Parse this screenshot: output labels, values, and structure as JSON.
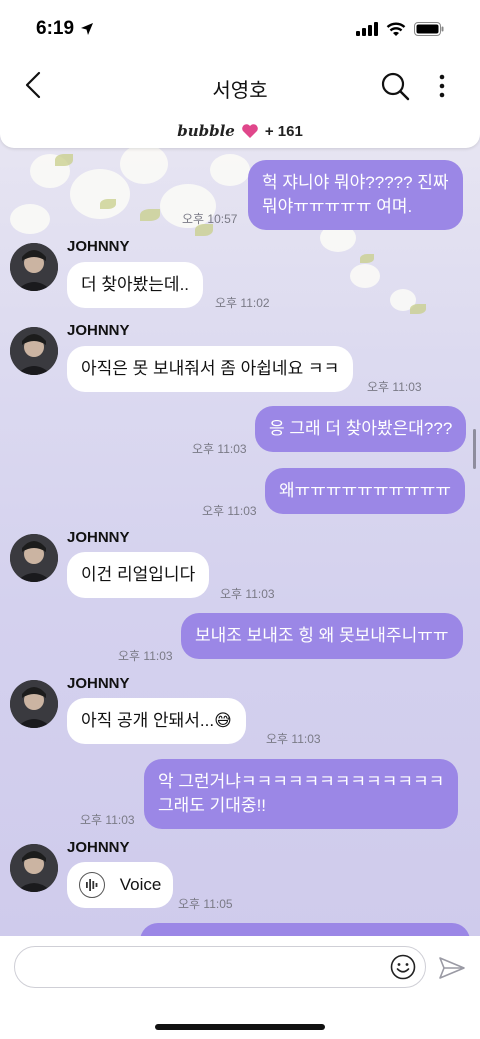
{
  "status_bar": {
    "time": "6:19"
  },
  "header": {
    "title": "서영호"
  },
  "banner": {
    "brand": "bubble",
    "count": "+ 161"
  },
  "sender_name": "JOHNNY",
  "messages": [
    {
      "dir": "out",
      "lines": [
        "헉 쟈니야 뭐야????? 진짜",
        "뭐야ㅠㅠㅠㅠㅠ 여며."
      ],
      "time": "오후 10:57"
    },
    {
      "dir": "in",
      "text": "더 찾아봤는데..",
      "time": "오후 11:02"
    },
    {
      "dir": "in",
      "text": "아직은 못 보내줘서 좀 아쉽네요 ㅋㅋ",
      "time": "오후 11:03"
    },
    {
      "dir": "out",
      "text": "응 그래 더 찾아봤은대???",
      "time": "오후 11:03"
    },
    {
      "dir": "out",
      "text": "왜ㅠㅠㅠㅠㅠㅠㅠㅠㅠㅠ",
      "time": "오후 11:03"
    },
    {
      "dir": "in",
      "text": "이건 리얼입니다",
      "time": "오후 11:03"
    },
    {
      "dir": "out",
      "text": "보내조 보내조 힝 왜 못보내주니ㅠㅠ",
      "time": "오후 11:03"
    },
    {
      "dir": "in",
      "text": "아직 공개 안돼서...😅",
      "time": "오후 11:03"
    },
    {
      "dir": "out",
      "lines": [
        "악 그런거냐ㅋㅋㅋㅋㅋㅋㅋㅋㅋㅋㅋㅋㅋ",
        "그래도 기대중!!"
      ],
      "time": "오후 11:03"
    },
    {
      "dir": "in",
      "text": "Voice",
      "time": "오후 11:05"
    }
  ],
  "input": {
    "placeholder": ""
  },
  "colors": {
    "outgoing_bubble": "#9b87e6",
    "incoming_bubble": "#ffffff",
    "heart": "#e0478b"
  },
  "icons": [
    "back-chevron-icon",
    "search-icon",
    "more-vertical-icon",
    "heart-icon",
    "voice-wave-icon",
    "smiley-icon",
    "send-icon"
  ]
}
